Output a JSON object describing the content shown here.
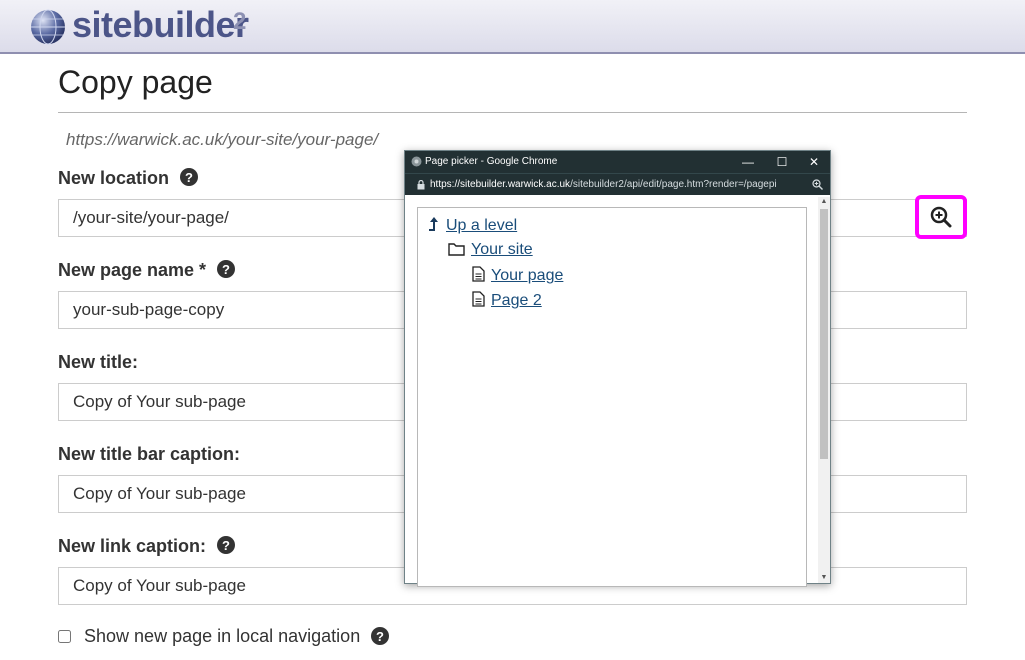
{
  "header": {
    "logo_text": "sitebuilder",
    "logo_sup": "2",
    "accent": "#4c5588"
  },
  "page": {
    "title": "Copy page",
    "current_url": "https://warwick.ac.uk/your-site/your-page/"
  },
  "form": {
    "location_label": "New location",
    "location_value": "/your-site/your-page/",
    "page_name_label": "New page name *",
    "page_name_value": "your-sub-page-copy",
    "title_label": "New title:",
    "title_value": "Copy of Your sub-page",
    "titlebar_label": "New title bar caption:",
    "titlebar_value": "Copy of Your sub-page",
    "link_caption_label": "New link caption:",
    "link_caption_value": "Copy of Your sub-page",
    "show_nav_label": "Show new page in local navigation",
    "show_nav_checked": false,
    "picker_button_icon": "zoom-in-icon",
    "highlight_color": "#ff00ff"
  },
  "popup": {
    "window_title": "Page picker - Google Chrome",
    "url_host": "https://sitebuilder.warwick.ac.uk",
    "url_path": "/sitebuilder2/api/edit/page.htm?render=/pagepi",
    "minimize": "—",
    "maximize": "☐",
    "close": "✕",
    "tree": {
      "up": "Up a level",
      "site": "Your site",
      "page1": "Your page",
      "page2": "Page 2"
    }
  }
}
